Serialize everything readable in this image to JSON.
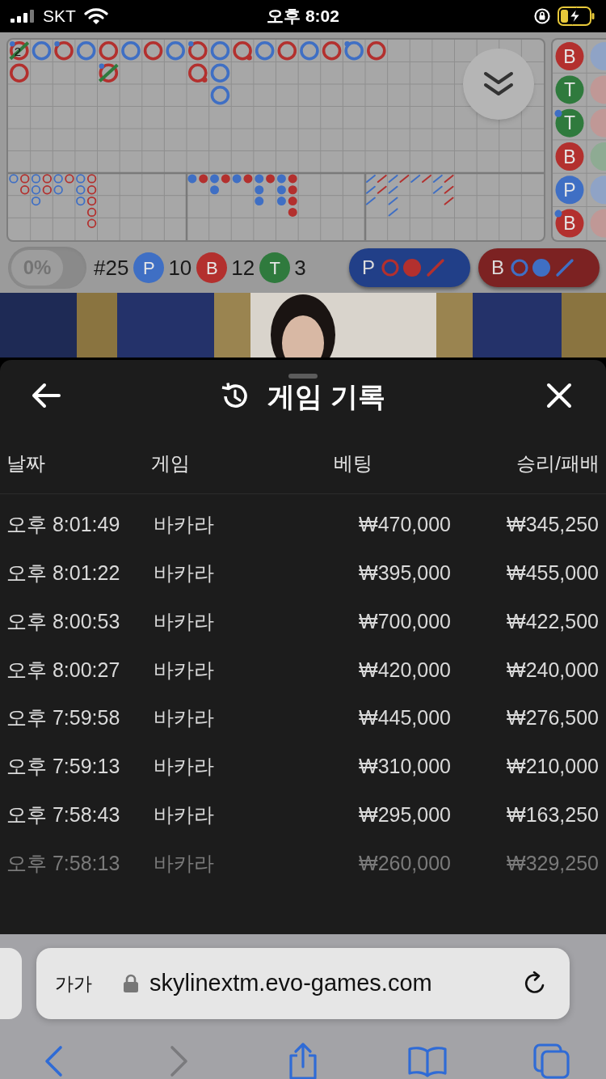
{
  "status_bar": {
    "carrier": "SKT",
    "time": "오후 8:02"
  },
  "big_road": {
    "columns": [
      [
        {
          "color": "#b3302e",
          "player_pair": true,
          "banker_pair": false,
          "tie": true,
          "tie_count": "2"
        },
        {
          "color": "#b3302e",
          "player_pair": false,
          "banker_pair": false,
          "tie": false
        }
      ],
      [
        {
          "color": "#3f6fc4",
          "player_pair": false,
          "banker_pair": false,
          "tie": false
        }
      ],
      [
        {
          "color": "#b3302e",
          "player_pair": true,
          "banker_pair": false,
          "tie": false
        }
      ],
      [
        {
          "color": "#3f6fc4",
          "player_pair": false,
          "banker_pair": false,
          "tie": false
        }
      ],
      [
        {
          "color": "#b3302e",
          "player_pair": false,
          "banker_pair": false,
          "tie": false
        },
        {
          "color": "#b3302e",
          "player_pair": true,
          "banker_pair": false,
          "tie": true
        }
      ],
      [
        {
          "color": "#3f6fc4",
          "player_pair": false,
          "banker_pair": false,
          "tie": false
        }
      ],
      [
        {
          "color": "#b3302e",
          "player_pair": false,
          "banker_pair": false,
          "tie": false
        }
      ],
      [
        {
          "color": "#3f6fc4",
          "player_pair": false,
          "banker_pair": false,
          "tie": false
        }
      ],
      [
        {
          "color": "#b3302e",
          "player_pair": true,
          "banker_pair": false,
          "tie": false
        },
        {
          "color": "#b3302e",
          "player_pair": false,
          "banker_pair": true,
          "tie": false
        }
      ],
      [
        {
          "color": "#3f6fc4",
          "player_pair": false,
          "banker_pair": false,
          "tie": false
        },
        {
          "color": "#3f6fc4",
          "player_pair": false,
          "banker_pair": false,
          "tie": false
        },
        {
          "color": "#3f6fc4",
          "player_pair": false,
          "banker_pair": false,
          "tie": false
        }
      ],
      [
        {
          "color": "#b3302e",
          "player_pair": false,
          "banker_pair": true,
          "tie": false
        }
      ],
      [
        {
          "color": "#3f6fc4",
          "player_pair": false,
          "banker_pair": false,
          "tie": false
        }
      ],
      [
        {
          "color": "#b3302e",
          "player_pair": false,
          "banker_pair": false,
          "tie": false
        }
      ],
      [
        {
          "color": "#3f6fc4",
          "player_pair": false,
          "banker_pair": false,
          "tie": false
        }
      ],
      [
        {
          "color": "#b3302e",
          "player_pair": false,
          "banker_pair": false,
          "tie": false
        }
      ],
      [
        {
          "color": "#3f6fc4",
          "player_pair": true,
          "banker_pair": false,
          "tie": false
        }
      ],
      [
        {
          "color": "#b3302e",
          "player_pair": false,
          "banker_pair": false,
          "tie": false
        }
      ]
    ]
  },
  "big_eye_road": {
    "columns": [
      [
        {
          "color": "#3f6fc4"
        }
      ],
      [
        {
          "color": "#b3302e"
        },
        {
          "color": "#b3302e"
        }
      ],
      [
        {
          "color": "#3f6fc4"
        },
        {
          "color": "#3f6fc4"
        },
        {
          "color": "#3f6fc4"
        }
      ],
      [
        {
          "color": "#b3302e"
        },
        {
          "color": "#b3302e"
        }
      ],
      [
        {
          "color": "#3f6fc4"
        },
        {
          "color": "#3f6fc4"
        }
      ],
      [
        {
          "color": "#b3302e"
        }
      ],
      [
        {
          "color": "#3f6fc4"
        },
        {
          "color": "#3f6fc4"
        },
        {
          "color": "#3f6fc4"
        }
      ],
      [
        {
          "color": "#b3302e"
        },
        {
          "color": "#b3302e"
        },
        {
          "color": "#b3302e"
        },
        {
          "color": "#b3302e"
        },
        {
          "color": "#b3302e"
        }
      ]
    ]
  },
  "small_road": {
    "columns": [
      [
        {
          "color": "#3f6fc4"
        }
      ],
      [
        {
          "color": "#b3302e"
        }
      ],
      [
        {
          "color": "#3f6fc4"
        },
        {
          "color": "#3f6fc4"
        }
      ],
      [
        {
          "color": "#b3302e"
        }
      ],
      [
        {
          "color": "#3f6fc4"
        }
      ],
      [
        {
          "color": "#b3302e"
        }
      ],
      [
        {
          "color": "#3f6fc4"
        },
        {
          "color": "#3f6fc4"
        },
        {
          "color": "#3f6fc4"
        }
      ],
      [
        {
          "color": "#b3302e"
        }
      ],
      [
        {
          "color": "#3f6fc4"
        },
        {
          "color": "#3f6fc4"
        },
        {
          "color": "#3f6fc4"
        }
      ],
      [
        {
          "color": "#b3302e"
        },
        {
          "color": "#b3302e"
        },
        {
          "color": "#b3302e"
        },
        {
          "color": "#b3302e"
        }
      ]
    ]
  },
  "cockroach_road": {
    "columns": [
      [
        {
          "color": "#3f6fc4"
        },
        {
          "color": "#3f6fc4"
        },
        {
          "color": "#3f6fc4"
        }
      ],
      [
        {
          "color": "#b3302e"
        },
        {
          "color": "#b3302e"
        }
      ],
      [
        {
          "color": "#3f6fc4"
        },
        {
          "color": "#3f6fc4"
        },
        {
          "color": "#3f6fc4"
        },
        {
          "color": "#3f6fc4"
        }
      ],
      [
        {
          "color": "#b3302e"
        }
      ],
      [
        {
          "color": "#3f6fc4"
        }
      ],
      [
        {
          "color": "#b3302e"
        }
      ],
      [
        {
          "color": "#3f6fc4"
        },
        {
          "color": "#3f6fc4"
        }
      ],
      [
        {
          "color": "#b3302e"
        },
        {
          "color": "#b3302e"
        },
        {
          "color": "#b3302e"
        }
      ]
    ]
  },
  "bead_plate": {
    "column": [
      {
        "label": "B",
        "color": "#b3302e",
        "player_pair": false
      },
      {
        "label": "T",
        "color": "#2f7a3d",
        "player_pair": false
      },
      {
        "label": "T",
        "color": "#2f7a3d",
        "player_pair": true
      },
      {
        "label": "B",
        "color": "#b3302e",
        "player_pair": false
      },
      {
        "label": "P",
        "color": "#3f6fc4",
        "player_pair": false
      },
      {
        "label": "B",
        "color": "#b3302e",
        "player_pair": true
      }
    ],
    "cut_column": [
      {
        "color": "#8fa3c6"
      },
      {
        "color": "#c09896"
      },
      {
        "color": "#c09896"
      },
      {
        "color": "#8eab93"
      },
      {
        "color": "#8fa3c6"
      },
      {
        "color": "#c09896"
      }
    ]
  },
  "stats": {
    "percent": "0%",
    "round": "#25",
    "counts": [
      {
        "label": "P",
        "value": "10",
        "color": "#3f6fc4"
      },
      {
        "label": "B",
        "value": "12",
        "color": "#b3302e"
      },
      {
        "label": "T",
        "value": "3",
        "color": "#2f7a3d"
      }
    ]
  },
  "predictions": [
    {
      "label": "P",
      "color": "#213f88",
      "next": {
        "color": "#b3302e"
      }
    },
    {
      "label": "B",
      "color": "#7c2222",
      "next": {
        "color": "#3f6fc4"
      }
    }
  ],
  "sheet": {
    "title": "게임 기록",
    "columns": [
      "날짜",
      "게임",
      "베팅",
      "승리/패배"
    ],
    "rows": [
      {
        "date": "오후 8:01:49",
        "game": "바카라",
        "bet": "₩470,000",
        "result": "₩345,250",
        "faded": false
      },
      {
        "date": "오후 8:01:22",
        "game": "바카라",
        "bet": "₩395,000",
        "result": "₩455,000",
        "faded": false
      },
      {
        "date": "오후 8:00:53",
        "game": "바카라",
        "bet": "₩700,000",
        "result": "₩422,500",
        "faded": false
      },
      {
        "date": "오후 8:00:27",
        "game": "바카라",
        "bet": "₩420,000",
        "result": "₩240,000",
        "faded": false
      },
      {
        "date": "오후 7:59:58",
        "game": "바카라",
        "bet": "₩445,000",
        "result": "₩276,500",
        "faded": false
      },
      {
        "date": "오후 7:59:13",
        "game": "바카라",
        "bet": "₩310,000",
        "result": "₩210,000",
        "faded": false
      },
      {
        "date": "오후 7:58:43",
        "game": "바카라",
        "bet": "₩295,000",
        "result": "₩163,250",
        "faded": false
      },
      {
        "date": "오후 7:58:13",
        "game": "바카라",
        "bet": "₩260,000",
        "result": "₩329,250",
        "faded": true
      }
    ]
  },
  "browser": {
    "text_size": "가가",
    "url": "skylinextm.evo-games.com",
    "toolbar": [
      {
        "kind": "back",
        "disabled": false
      },
      {
        "kind": "forward",
        "disabled": true
      },
      {
        "kind": "share",
        "disabled": false
      },
      {
        "kind": "bookmarks",
        "disabled": false
      },
      {
        "kind": "tabs",
        "disabled": false
      }
    ]
  }
}
